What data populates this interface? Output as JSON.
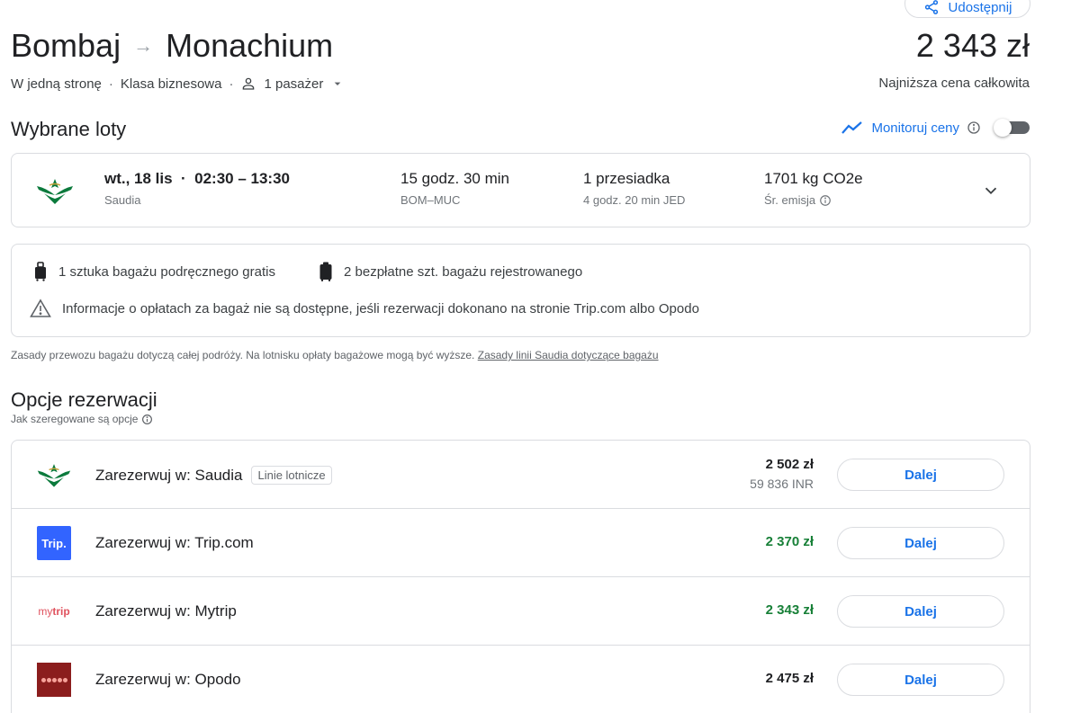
{
  "header": {
    "share_label": "Udostępnij",
    "origin": "Bombaj",
    "arrow": "→",
    "destination": "Monachium",
    "total_price": "2 343 zł",
    "trip_type": "W jedną stronę",
    "cabin": "Klasa biznesowa",
    "passengers": "1 pasażer",
    "lowest_price_label": "Najniższa cena całkowita"
  },
  "selected": {
    "heading": "Wybrane loty",
    "track_label": "Monitoruj ceny",
    "flight": {
      "date_time": "wt., 18 lis  ·  02:30 – 13:30",
      "airline": "Saudia",
      "duration": "15 godz. 30 min",
      "route": "BOM–MUC",
      "stops": "1 przesiadka",
      "layover": "4 godz. 20 min JED",
      "emissions": "1701 kg CO2e",
      "emissions_label": "Śr. emisja"
    }
  },
  "baggage": {
    "carry_on": "1 sztuka bagażu podręcznego gratis",
    "checked": "2 bezpłatne szt. bagażu rejestrowanego",
    "warning": "Informacje o opłatach za bagaż nie są dostępne, jeśli rezerwacji dokonano na stronie Trip.com albo Opodo",
    "note": "Zasady przewozu bagażu dotyczą całej podróży. Na lotnisku opłaty bagażowe mogą być wyższe.",
    "note_link": "Zasady linii Saudia dotyczące bagażu"
  },
  "booking": {
    "heading": "Opcje rezerwacji",
    "subheading": "Jak szeregowane są opcje",
    "options": [
      {
        "name": "Zarezerwuj w: Saudia",
        "tag": "Linie lotnicze",
        "price": "2 502 zł",
        "price_alt": "59 836 INR",
        "cta": "Dalej"
      },
      {
        "name": "Zarezerwuj w: Trip.com",
        "logo_text": "Trip.",
        "price": "2 370 zł",
        "cta": "Dalej"
      },
      {
        "name": "Zarezerwuj w: Mytrip",
        "logo_text_a": "my",
        "logo_text_b": "trip",
        "price": "2 343 zł",
        "cta": "Dalej"
      },
      {
        "name": "Zarezerwuj w: Opodo",
        "price": "2 475 zł",
        "cta": "Dalej"
      }
    ]
  },
  "colors": {
    "accent": "#1a73e8",
    "price_green": "#188038",
    "saudia_green": "#0b7a3c"
  }
}
